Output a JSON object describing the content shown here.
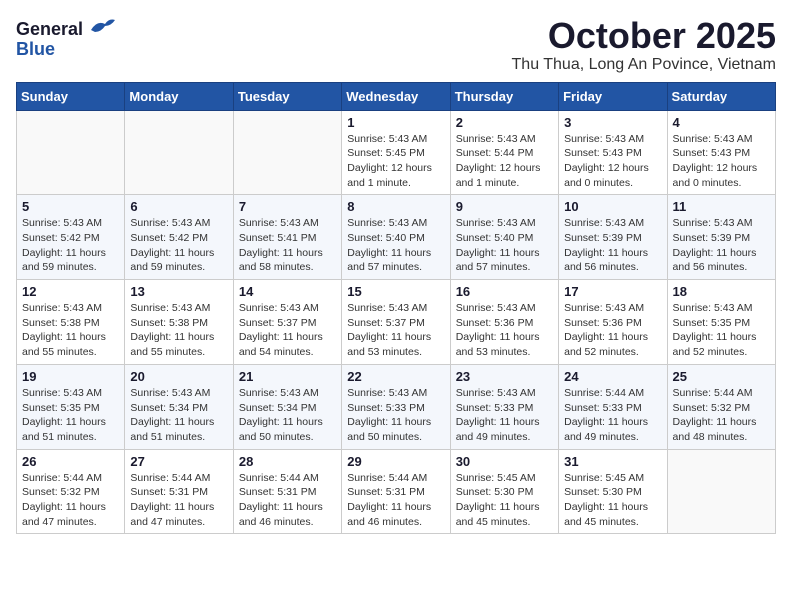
{
  "logo": {
    "general": "General",
    "blue": "Blue"
  },
  "header": {
    "title": "October 2025",
    "subtitle": "Thu Thua, Long An Povince, Vietnam"
  },
  "weekdays": [
    "Sunday",
    "Monday",
    "Tuesday",
    "Wednesday",
    "Thursday",
    "Friday",
    "Saturday"
  ],
  "weeks": [
    [
      {
        "day": "",
        "sunrise": "",
        "sunset": "",
        "daylight": ""
      },
      {
        "day": "",
        "sunrise": "",
        "sunset": "",
        "daylight": ""
      },
      {
        "day": "",
        "sunrise": "",
        "sunset": "",
        "daylight": ""
      },
      {
        "day": "1",
        "sunrise": "Sunrise: 5:43 AM",
        "sunset": "Sunset: 5:45 PM",
        "daylight": "Daylight: 12 hours and 1 minute."
      },
      {
        "day": "2",
        "sunrise": "Sunrise: 5:43 AM",
        "sunset": "Sunset: 5:44 PM",
        "daylight": "Daylight: 12 hours and 1 minute."
      },
      {
        "day": "3",
        "sunrise": "Sunrise: 5:43 AM",
        "sunset": "Sunset: 5:43 PM",
        "daylight": "Daylight: 12 hours and 0 minutes."
      },
      {
        "day": "4",
        "sunrise": "Sunrise: 5:43 AM",
        "sunset": "Sunset: 5:43 PM",
        "daylight": "Daylight: 12 hours and 0 minutes."
      }
    ],
    [
      {
        "day": "5",
        "sunrise": "Sunrise: 5:43 AM",
        "sunset": "Sunset: 5:42 PM",
        "daylight": "Daylight: 11 hours and 59 minutes."
      },
      {
        "day": "6",
        "sunrise": "Sunrise: 5:43 AM",
        "sunset": "Sunset: 5:42 PM",
        "daylight": "Daylight: 11 hours and 59 minutes."
      },
      {
        "day": "7",
        "sunrise": "Sunrise: 5:43 AM",
        "sunset": "Sunset: 5:41 PM",
        "daylight": "Daylight: 11 hours and 58 minutes."
      },
      {
        "day": "8",
        "sunrise": "Sunrise: 5:43 AM",
        "sunset": "Sunset: 5:40 PM",
        "daylight": "Daylight: 11 hours and 57 minutes."
      },
      {
        "day": "9",
        "sunrise": "Sunrise: 5:43 AM",
        "sunset": "Sunset: 5:40 PM",
        "daylight": "Daylight: 11 hours and 57 minutes."
      },
      {
        "day": "10",
        "sunrise": "Sunrise: 5:43 AM",
        "sunset": "Sunset: 5:39 PM",
        "daylight": "Daylight: 11 hours and 56 minutes."
      },
      {
        "day": "11",
        "sunrise": "Sunrise: 5:43 AM",
        "sunset": "Sunset: 5:39 PM",
        "daylight": "Daylight: 11 hours and 56 minutes."
      }
    ],
    [
      {
        "day": "12",
        "sunrise": "Sunrise: 5:43 AM",
        "sunset": "Sunset: 5:38 PM",
        "daylight": "Daylight: 11 hours and 55 minutes."
      },
      {
        "day": "13",
        "sunrise": "Sunrise: 5:43 AM",
        "sunset": "Sunset: 5:38 PM",
        "daylight": "Daylight: 11 hours and 55 minutes."
      },
      {
        "day": "14",
        "sunrise": "Sunrise: 5:43 AM",
        "sunset": "Sunset: 5:37 PM",
        "daylight": "Daylight: 11 hours and 54 minutes."
      },
      {
        "day": "15",
        "sunrise": "Sunrise: 5:43 AM",
        "sunset": "Sunset: 5:37 PM",
        "daylight": "Daylight: 11 hours and 53 minutes."
      },
      {
        "day": "16",
        "sunrise": "Sunrise: 5:43 AM",
        "sunset": "Sunset: 5:36 PM",
        "daylight": "Daylight: 11 hours and 53 minutes."
      },
      {
        "day": "17",
        "sunrise": "Sunrise: 5:43 AM",
        "sunset": "Sunset: 5:36 PM",
        "daylight": "Daylight: 11 hours and 52 minutes."
      },
      {
        "day": "18",
        "sunrise": "Sunrise: 5:43 AM",
        "sunset": "Sunset: 5:35 PM",
        "daylight": "Daylight: 11 hours and 52 minutes."
      }
    ],
    [
      {
        "day": "19",
        "sunrise": "Sunrise: 5:43 AM",
        "sunset": "Sunset: 5:35 PM",
        "daylight": "Daylight: 11 hours and 51 minutes."
      },
      {
        "day": "20",
        "sunrise": "Sunrise: 5:43 AM",
        "sunset": "Sunset: 5:34 PM",
        "daylight": "Daylight: 11 hours and 51 minutes."
      },
      {
        "day": "21",
        "sunrise": "Sunrise: 5:43 AM",
        "sunset": "Sunset: 5:34 PM",
        "daylight": "Daylight: 11 hours and 50 minutes."
      },
      {
        "day": "22",
        "sunrise": "Sunrise: 5:43 AM",
        "sunset": "Sunset: 5:33 PM",
        "daylight": "Daylight: 11 hours and 50 minutes."
      },
      {
        "day": "23",
        "sunrise": "Sunrise: 5:43 AM",
        "sunset": "Sunset: 5:33 PM",
        "daylight": "Daylight: 11 hours and 49 minutes."
      },
      {
        "day": "24",
        "sunrise": "Sunrise: 5:44 AM",
        "sunset": "Sunset: 5:33 PM",
        "daylight": "Daylight: 11 hours and 49 minutes."
      },
      {
        "day": "25",
        "sunrise": "Sunrise: 5:44 AM",
        "sunset": "Sunset: 5:32 PM",
        "daylight": "Daylight: 11 hours and 48 minutes."
      }
    ],
    [
      {
        "day": "26",
        "sunrise": "Sunrise: 5:44 AM",
        "sunset": "Sunset: 5:32 PM",
        "daylight": "Daylight: 11 hours and 47 minutes."
      },
      {
        "day": "27",
        "sunrise": "Sunrise: 5:44 AM",
        "sunset": "Sunset: 5:31 PM",
        "daylight": "Daylight: 11 hours and 47 minutes."
      },
      {
        "day": "28",
        "sunrise": "Sunrise: 5:44 AM",
        "sunset": "Sunset: 5:31 PM",
        "daylight": "Daylight: 11 hours and 46 minutes."
      },
      {
        "day": "29",
        "sunrise": "Sunrise: 5:44 AM",
        "sunset": "Sunset: 5:31 PM",
        "daylight": "Daylight: 11 hours and 46 minutes."
      },
      {
        "day": "30",
        "sunrise": "Sunrise: 5:45 AM",
        "sunset": "Sunset: 5:30 PM",
        "daylight": "Daylight: 11 hours and 45 minutes."
      },
      {
        "day": "31",
        "sunrise": "Sunrise: 5:45 AM",
        "sunset": "Sunset: 5:30 PM",
        "daylight": "Daylight: 11 hours and 45 minutes."
      },
      {
        "day": "",
        "sunrise": "",
        "sunset": "",
        "daylight": ""
      }
    ]
  ]
}
